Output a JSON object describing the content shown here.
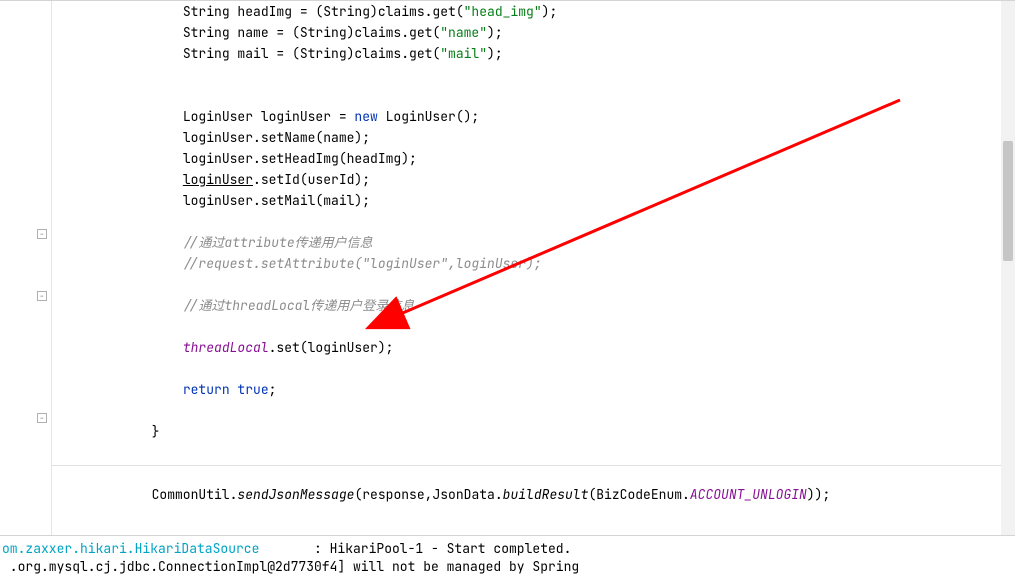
{
  "code": {
    "indent1": "            ",
    "indent2": "                ",
    "line0a": "String name = (String)claims.get(",
    "line0s": "\"name\"",
    "line0b": ");",
    "line1a": "String mail = (String)claims.get(",
    "line1s": "\"mail\"",
    "line1b": ");",
    "line4a": "LoginUser loginUser = ",
    "line4kw": "new",
    "line4b": " LoginUser();",
    "line5": "loginUser.setName(name);",
    "line6": "loginUser.setHeadImg(headImg);",
    "line7a": "loginUser",
    "line7b": ".setId(userId);",
    "line8": "loginUser.setMail(mail);",
    "line10": "//通过attribute传递用户信息",
    "line11": "//request.setAttribute(\"loginUser\",loginUser);",
    "line13": "//通过threadLocal传递用户登录信息",
    "line15a": "threadLocal",
    "line15b": ".set(loginUser);",
    "line17kw": "return",
    "line17true": " true",
    "line17end": ";",
    "brace": "}",
    "line22a": "CommonUtil.",
    "line22b": "sendJsonMessage",
    "line22c": "(response,JsonData.",
    "line22d": "buildResult",
    "line22e": "(BizCodeEnum.",
    "line22f": "ACCOUNT_UNLOGIN",
    "line22g": "));"
  },
  "console": {
    "line1a": "om.zaxxer.hikari.HikariDataSource",
    "line1b": "       : HikariPool-1 - Start completed.",
    "line2": " .org.mysql.cj.jdbc.ConnectionImpl@2d7730f4] will not be managed by Spring"
  }
}
